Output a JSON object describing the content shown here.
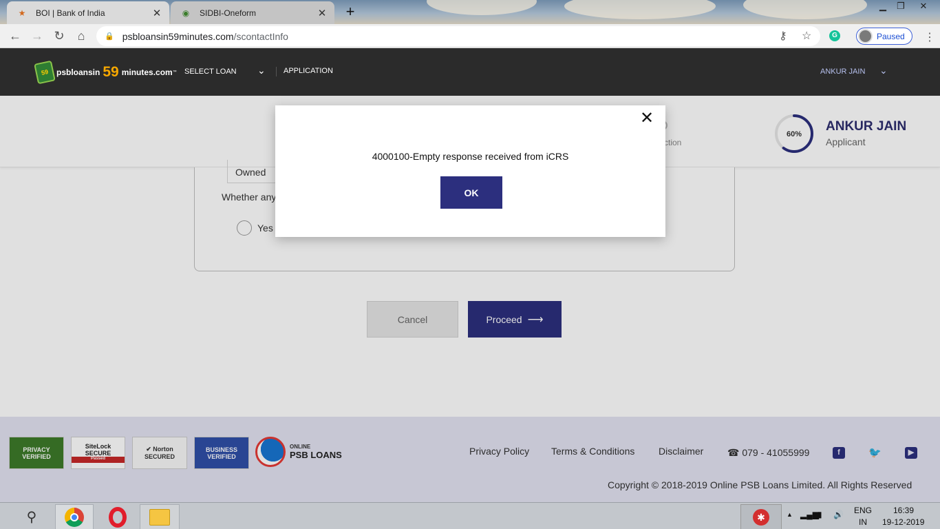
{
  "browser": {
    "tabs": [
      {
        "title": "BOI | Bank of India",
        "active": false
      },
      {
        "title": "SIDBI-Oneform",
        "active": true
      }
    ],
    "url_host": "psbloansin59minutes.com",
    "url_path": "/scontactInfo",
    "profile_label": "Paused",
    "icons": [
      "back-icon",
      "forward-icon",
      "reload-icon",
      "home-icon",
      "lock-icon",
      "key-icon",
      "star-icon",
      "grammarly-icon",
      "menu-icon"
    ]
  },
  "header": {
    "logo_part1": "psbloansin",
    "logo_part2": "59",
    "logo_part3": "minutes.com",
    "logo_badge": "59",
    "nav_select_loan": "SELECT LOAN",
    "nav_application": "APPLICATION",
    "user_name": "ANKUR JAIN"
  },
  "progress": {
    "percent": 60,
    "percent_label": "60%",
    "applicant_name": "ANKUR JAIN",
    "applicant_role": "Applicant"
  },
  "form": {
    "owned_value": "Owned",
    "question_partial": "Whether any",
    "radio_yes": "Yes"
  },
  "actions": {
    "cancel_label": "Cancel",
    "proceed_label": "Proceed"
  },
  "modal": {
    "message": "4000100-Empty response received from iCRS",
    "ok_label": "OK"
  },
  "footer": {
    "links": [
      "Privacy Policy",
      "Terms & Conditions",
      "Disclaimer"
    ],
    "phone": "079 - 41055999",
    "copyright": "Copyright © 2018-2019 Online PSB Loans Limited. All Rights Reserved",
    "psb_logo_top": "ONLINE",
    "psb_logo_bottom": "PSB LOANS"
  },
  "taskbar": {
    "lang_top": "ENG",
    "lang_bottom": "IN",
    "time": "16:39",
    "date": "19-12-2019"
  },
  "colors": {
    "brand_navy": "#2c2f7e",
    "header_bg": "#2b2b2b",
    "footer_bg": "#e3e3f2",
    "logo_orange": "#f7a800"
  }
}
